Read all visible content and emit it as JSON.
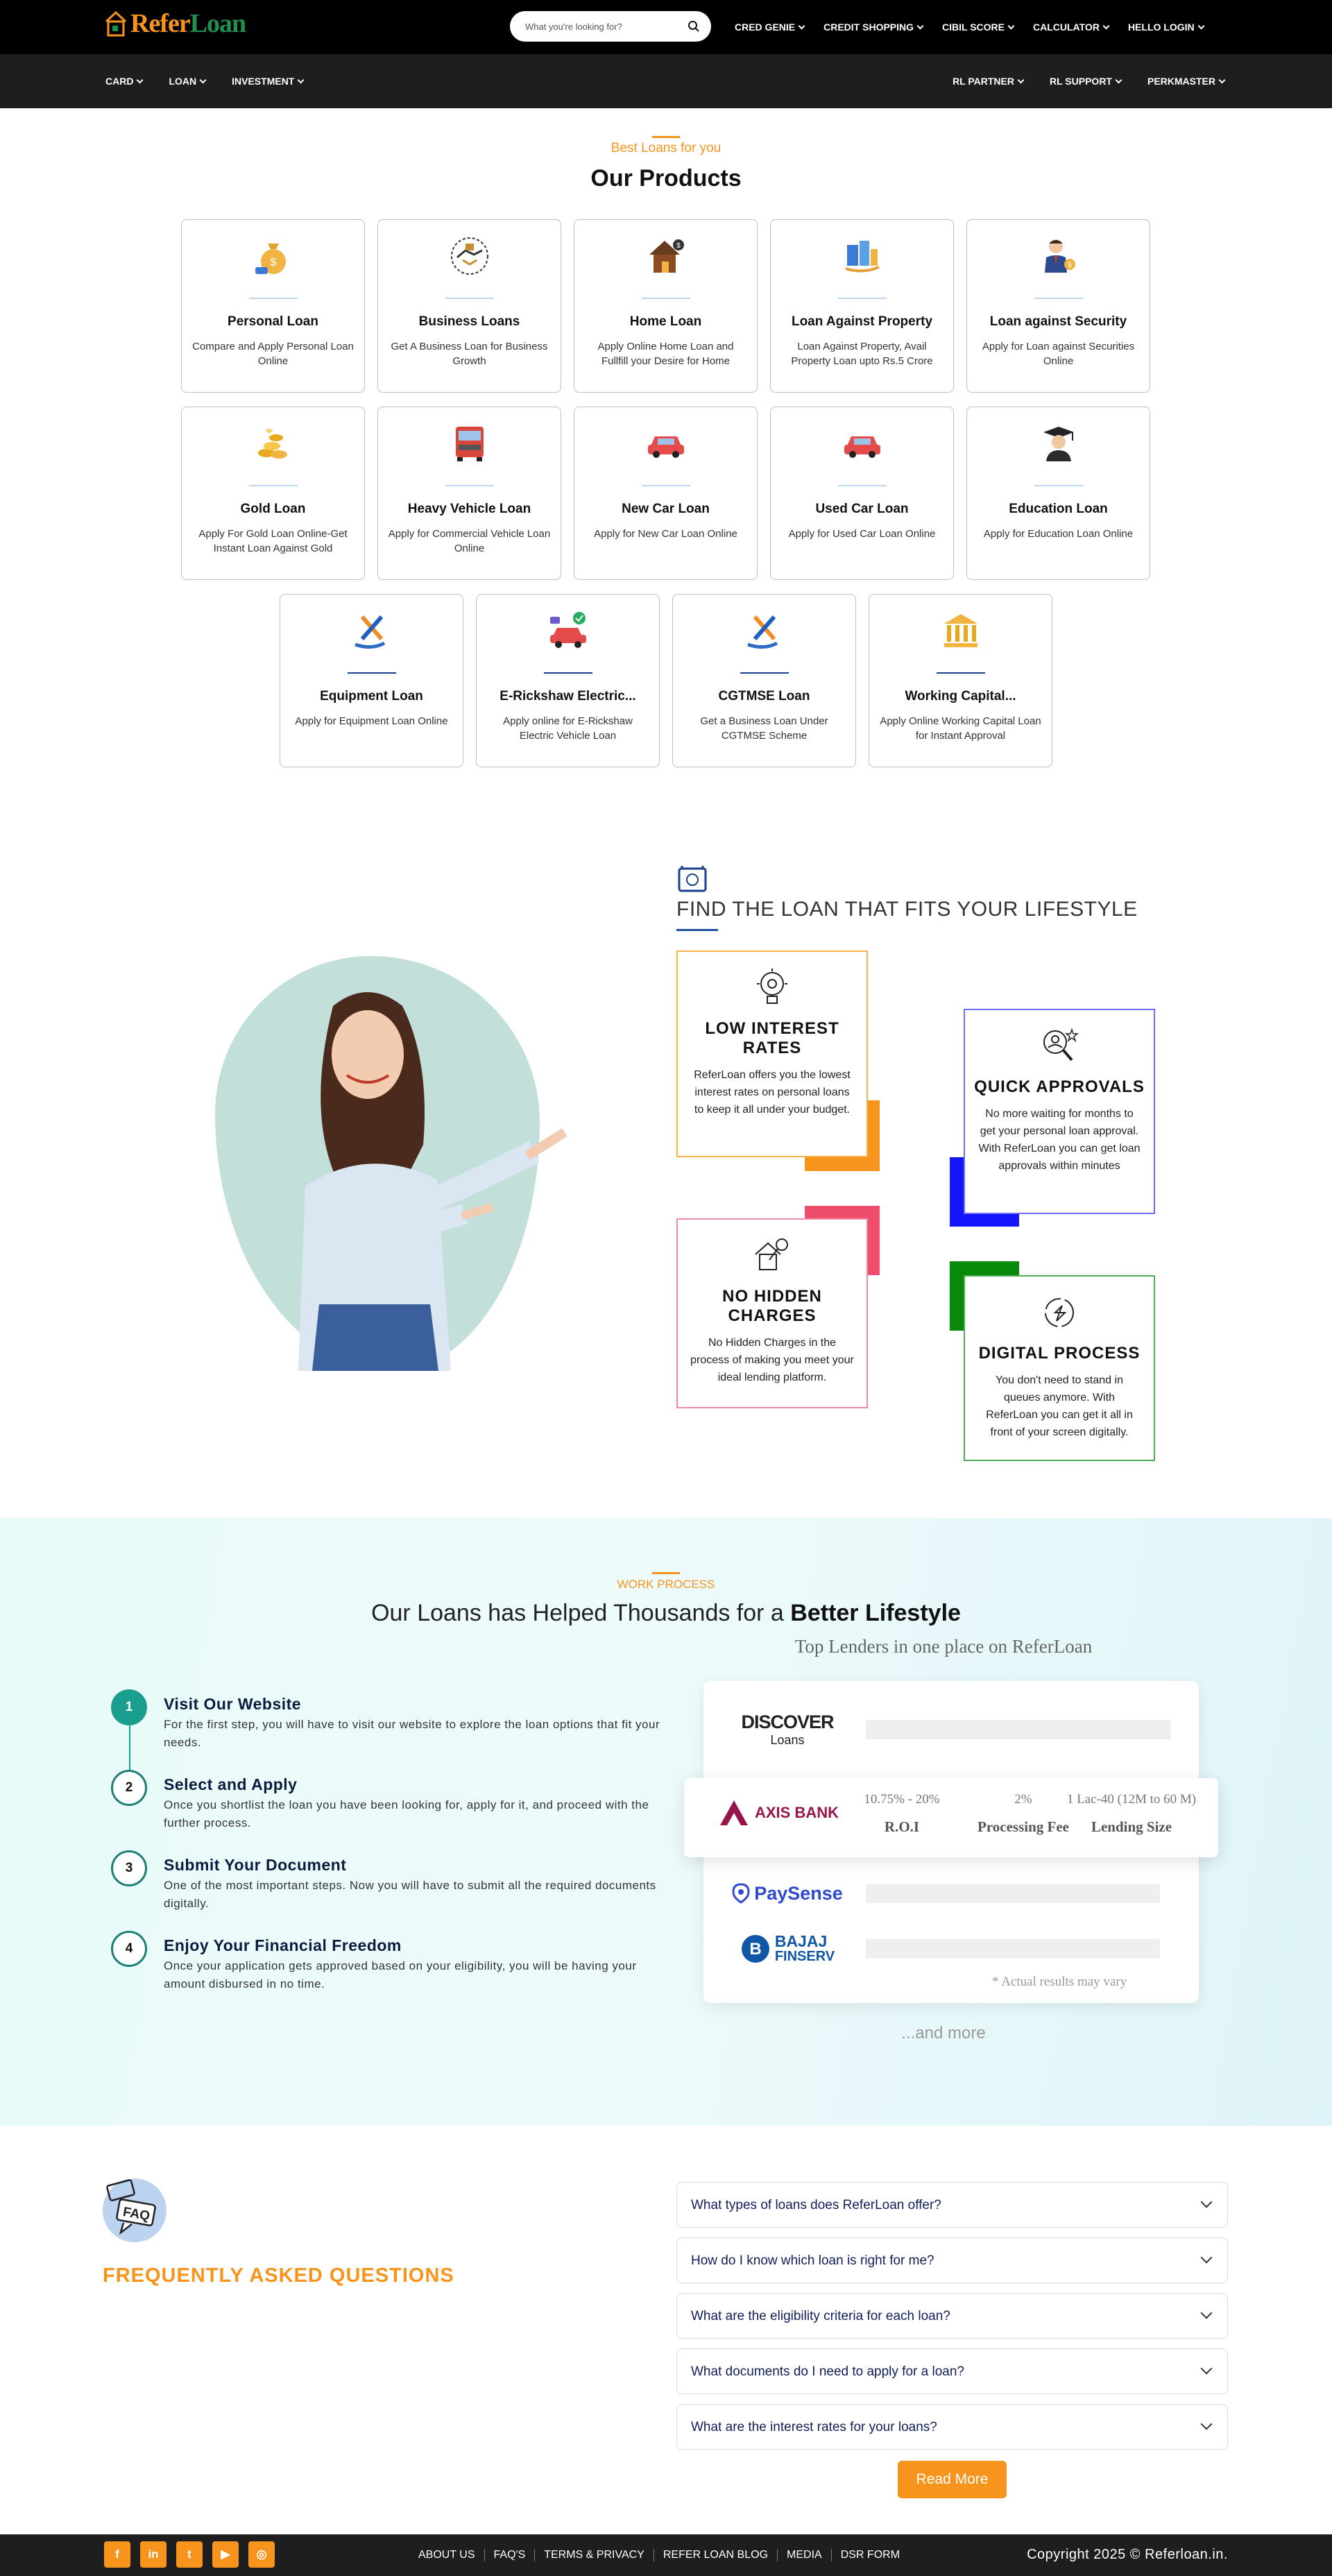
{
  "brand": {
    "name_part1": "Refer",
    "name_part2": "Loan",
    "orange": "#f7941d",
    "green": "#1f8f4e"
  },
  "search": {
    "placeholder": "What you're looking for?"
  },
  "top_nav": [
    "CRED GENIE",
    "CREDIT SHOPPING",
    "CIBIL SCORE",
    "CALCULATOR",
    "HELLO LOGIN"
  ],
  "sub_nav_left": [
    "CARD",
    "LOAN",
    "INVESTMENT"
  ],
  "sub_nav_right": [
    "RL PARTNER",
    "RL SUPPORT",
    "PERKMASTER"
  ],
  "products": {
    "kicker": "Best Loans for you",
    "title": "Our Products",
    "items": [
      {
        "title": "Personal Loan",
        "desc": "Compare and Apply Personal Loan Online",
        "icon": "money-bag-icon"
      },
      {
        "title": "Business Loans",
        "desc": "Get A Business Loan for Business Growth",
        "icon": "handshake-icon"
      },
      {
        "title": "Home Loan",
        "desc": "Apply Online Home Loan and Fullfill your Desire for Home",
        "icon": "house-icon"
      },
      {
        "title": "Loan Against Property",
        "desc": "Loan Against Property, Avail Property Loan upto Rs.5 Crore",
        "icon": "property-icon"
      },
      {
        "title": "Loan against Security",
        "desc": "Apply for Loan against Securities Online",
        "icon": "businessman-icon"
      },
      {
        "title": "Gold Loan",
        "desc": "Apply For Gold Loan Online-Get Instant Loan Against Gold",
        "icon": "gold-coins-icon"
      },
      {
        "title": "Heavy Vehicle Loan",
        "desc": "Apply for Commercial Vehicle Loan Online",
        "icon": "truck-icon"
      },
      {
        "title": "New Car Loan",
        "desc": "Apply for New Car Loan Online",
        "icon": "car-icon"
      },
      {
        "title": "Used Car Loan",
        "desc": "Apply for Used Car Loan Online",
        "icon": "car-icon"
      },
      {
        "title": "Education Loan",
        "desc": "Apply for Education Loan Online",
        "icon": "graduate-icon"
      },
      {
        "title": "Equipment Loan",
        "desc": "Apply for Equipment Loan Online",
        "icon": "tools-icon"
      },
      {
        "title": "E-Rickshaw Electric...",
        "desc": "Apply online for E-Rickshaw Electric Vehicle Loan",
        "icon": "electric-car-icon"
      },
      {
        "title": "CGTMSE Loan",
        "desc": "Get a Business Loan Under CGTMSE Scheme",
        "icon": "tools-icon"
      },
      {
        "title": "Working Capital...",
        "desc": "Apply Online Working Capital Loan for Instant Approval",
        "icon": "bank-icon"
      }
    ]
  },
  "find": {
    "title": "FIND THE LOAN THAT FITS YOUR LIFESTYLE",
    "features": [
      {
        "title": "LOW INTEREST RATES",
        "desc": "ReferLoan offers you the lowest interest rates on personal loans to keep it all under your budget.",
        "color": "#f7941d"
      },
      {
        "title": "QUICK APPROVALS",
        "desc": "No more waiting for months to get your personal loan approval. With ReferLoan you can get loan approvals within minutes",
        "color": "#1414ff"
      },
      {
        "title": "NO HIDDEN CHARGES",
        "desc": "No Hidden Charges in the process of making you meet your ideal lending platform.",
        "color": "#ee4d6b"
      },
      {
        "title": "DIGITAL PROCESS",
        "desc": "You don't need to stand in queues anymore. With ReferLoan you can get it all in front of your screen digitally.",
        "color": "#0a8a0a"
      }
    ]
  },
  "work": {
    "kicker": "WORK PROCESS",
    "title_plain": "Our Loans has Helped Thousands for a ",
    "title_bold": "Better Lifestyle",
    "steps": [
      {
        "num": "1",
        "title": "Visit Our Website",
        "desc": "For the first step, you will have to visit our website to explore the loan options that fit your needs."
      },
      {
        "num": "2",
        "title": "Select and Apply",
        "desc": "Once you shortlist the loan you have been looking for, apply for it, and proceed with the further process."
      },
      {
        "num": "3",
        "title": "Submit Your Document",
        "desc": "One of the most important steps. Now you will have to submit all the required documents digitally."
      },
      {
        "num": "4",
        "title": "Enjoy Your Financial Freedom",
        "desc": "Once your application gets approved based on your eligibility, you will be having your amount disbursed in no time."
      }
    ],
    "lenders_title": "Top Lenders in one place on ReferLoan",
    "discover": {
      "name": "DISCOVER",
      "sub": "Loans"
    },
    "axis": {
      "name": "AXIS BANK",
      "roi": "10.75% - 20%",
      "fee": "2%",
      "size": "1 Lac-40 (12M to 60 M)",
      "roi_label": "R.O.I",
      "fee_label": "Processing Fee",
      "size_label": "Lending Size"
    },
    "paysense": "PaySense",
    "bajaj": {
      "line1": "BAJAJ",
      "line2": "FINSERV"
    },
    "disclaimer": "* Actual results may vary",
    "more": "...and more"
  },
  "faq": {
    "badge": "FAQ",
    "title": "FREQUENTLY ASKED QUESTIONS",
    "items": [
      "What types of loans does ReferLoan offer?",
      "How do I know which loan is right for me?",
      "What are the eligibility criteria for each loan?",
      "What documents do I need to apply for a loan?",
      "What are the interest rates for your loans?"
    ],
    "read_more": "Read More"
  },
  "footer": {
    "socials": [
      "facebook-icon",
      "linkedin-icon",
      "twitter-icon",
      "youtube-icon",
      "instagram-icon"
    ],
    "social_glyphs": [
      "f",
      "in",
      "t",
      "▶",
      "◎"
    ],
    "links": [
      "ABOUT US",
      "FAQ'S",
      "TERMS & PRIVACY",
      "REFER LOAN BLOG",
      "MEDIA",
      "DSR FORM"
    ],
    "copyright": "Copyright 2025 © Referloan.in."
  }
}
